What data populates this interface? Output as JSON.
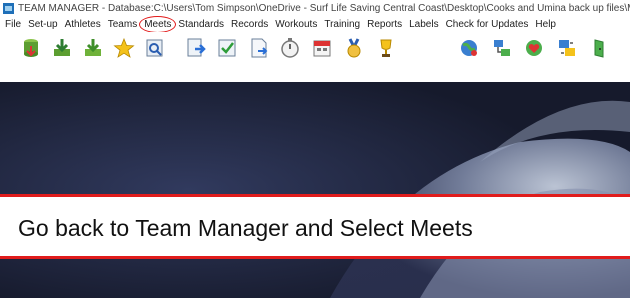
{
  "window": {
    "title": "TEAM MANAGER - Database:C:\\Users\\Tom Simpson\\OneDrive - Surf Life Saving Central Coast\\Desktop\\Cooks and Umina back up files\\M"
  },
  "menu": {
    "items": [
      {
        "label": "File"
      },
      {
        "label": "Set-up"
      },
      {
        "label": "Athletes"
      },
      {
        "label": "Teams"
      },
      {
        "label": "Meets",
        "highlighted": true
      },
      {
        "label": "Standards"
      },
      {
        "label": "Records"
      },
      {
        "label": "Workouts"
      },
      {
        "label": "Training"
      },
      {
        "label": "Reports"
      },
      {
        "label": "Labels"
      },
      {
        "label": "Check for Updates"
      },
      {
        "label": "Help"
      }
    ],
    "highlight_color": "#e21b1b"
  },
  "toolbar": {
    "icons": [
      "database-icon",
      "download-icon",
      "import-icon",
      "star-icon",
      "search-document-icon",
      "export-icon",
      "checklist-icon",
      "document-icon",
      "stopwatch-icon",
      "calendar-icon",
      "medal-icon",
      "trophy-icon",
      "globe-icon",
      "network-icon",
      "globe-heart-icon",
      "transfer-icon",
      "door-exit-icon"
    ]
  },
  "banner": {
    "text": "Go back to Team Manager and Select Meets",
    "border_color": "#e01c1c"
  }
}
